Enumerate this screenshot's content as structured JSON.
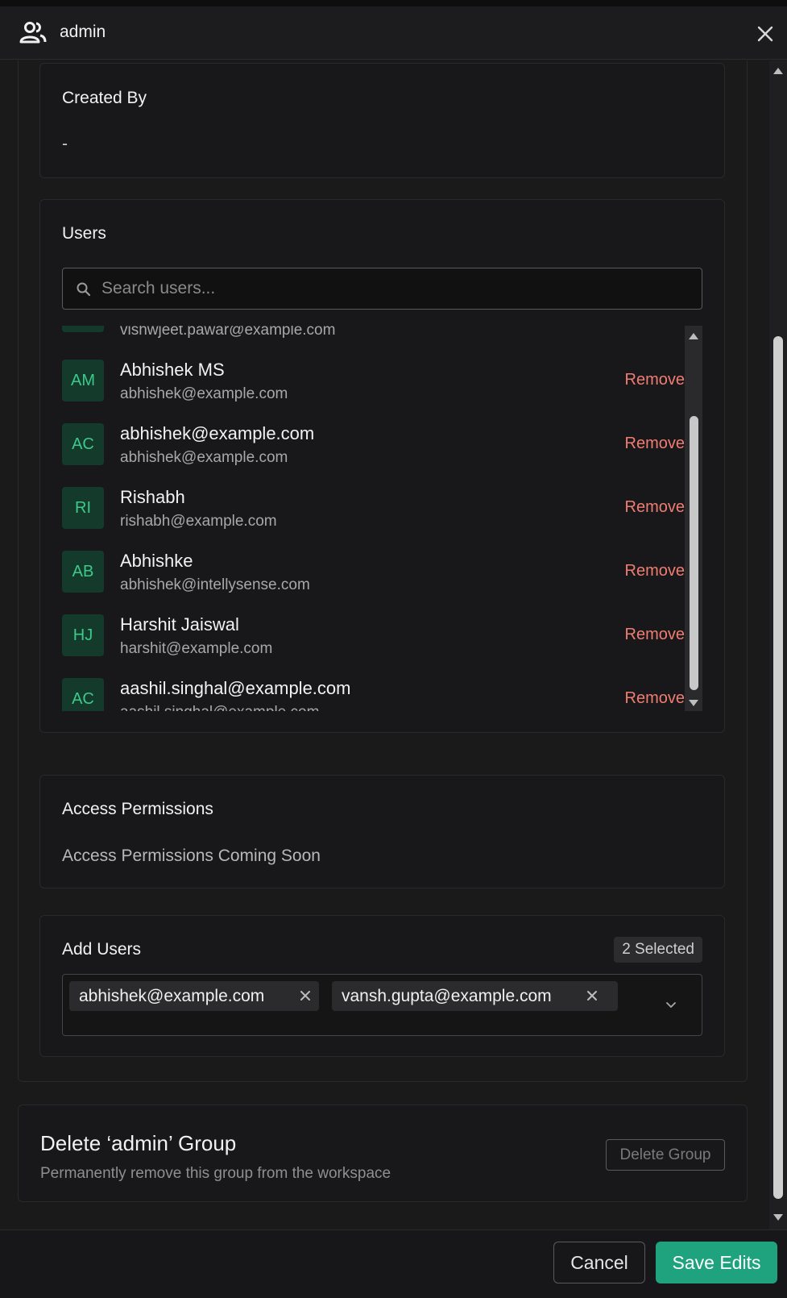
{
  "header": {
    "title": "admin"
  },
  "created_by": {
    "title": "Created By",
    "value": "-"
  },
  "users": {
    "title": "Users",
    "search_placeholder": "Search users...",
    "partial_email": "vishwjeet.pawar@example.com",
    "remove_label": "Remove",
    "items": [
      {
        "initials": "AM",
        "name": "Abhishek MS",
        "email": "abhishek@example.com"
      },
      {
        "initials": "AC",
        "name": "abhishek@example.com",
        "email": "abhishek@example.com"
      },
      {
        "initials": "RI",
        "name": "Rishabh",
        "email": "rishabh@example.com"
      },
      {
        "initials": "AB",
        "name": "Abhishke",
        "email": "abhishek@intellysense.com"
      },
      {
        "initials": "HJ",
        "name": "Harshit Jaiswal",
        "email": "harshit@example.com"
      },
      {
        "initials": "AC",
        "name": "aashil.singhal@example.com",
        "email": "aashil.singhal@example.com"
      }
    ]
  },
  "access": {
    "title": "Access Permissions",
    "text": "Access Permissions Coming Soon"
  },
  "add_users": {
    "title": "Add Users",
    "badge": "2 Selected",
    "chips": [
      "abhishek@example.com",
      "vansh.gupta@example.com"
    ]
  },
  "danger": {
    "title": "Delete ‘admin’ Group",
    "desc": "Permanently remove this group from the workspace",
    "button": "Delete Group"
  },
  "footer": {
    "cancel": "Cancel",
    "save": "Save Edits"
  },
  "colors": {
    "accent": "#1fa37f",
    "danger": "#f07d72",
    "avatar_bg": "#143a2c",
    "avatar_text": "#3cc98a"
  },
  "icons": {
    "header": "users-icon",
    "close": "close-icon",
    "search": "search-icon",
    "chevron": "chevron-down-icon",
    "chip_remove": "x-icon"
  }
}
